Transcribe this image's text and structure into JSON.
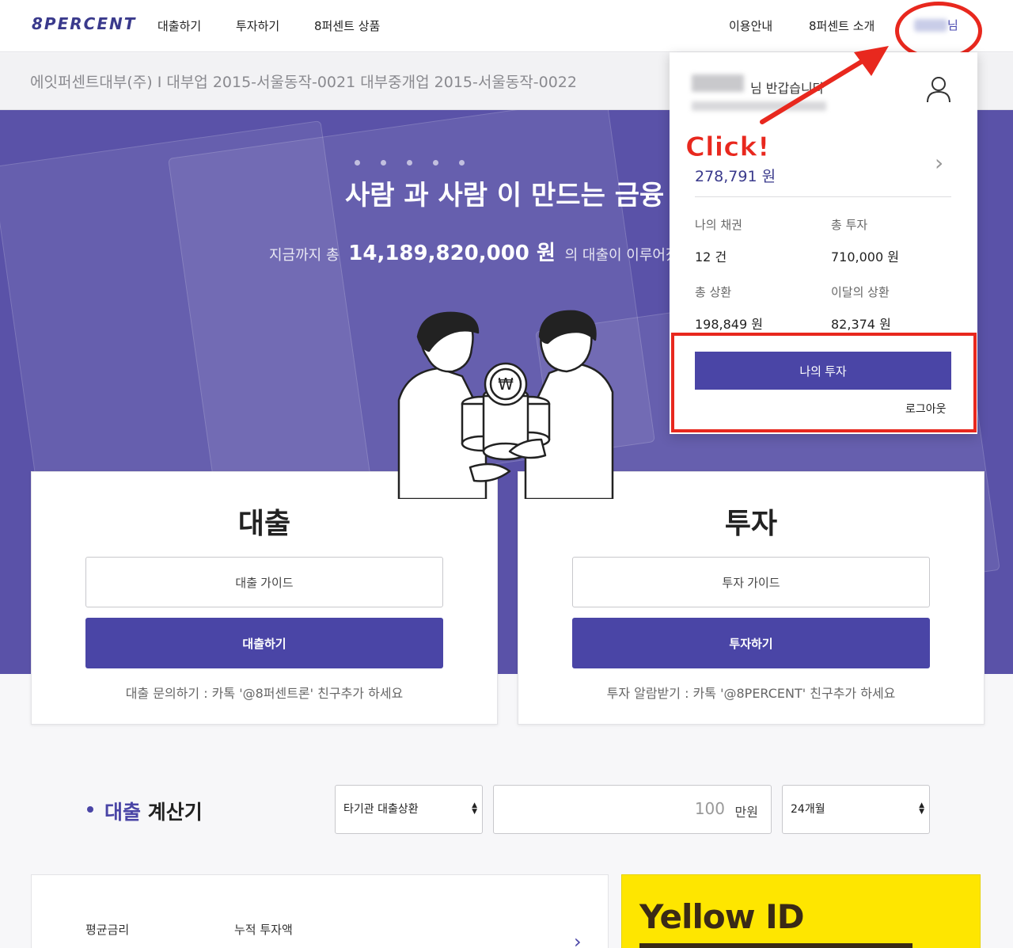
{
  "nav": {
    "logo": "8PERCENT",
    "links": [
      "대출하기",
      "투자하기",
      "8퍼센트 상품"
    ],
    "right_links": [
      "이용안내",
      "8퍼센트 소개"
    ],
    "user_suffix": "님"
  },
  "company": {
    "text": "에잇퍼센트대부(주) I 대부업 2015-서울동작-0021 대부중개업 2015-서울동작-0022"
  },
  "hero": {
    "title": "사람 과 사람 이 만드는 금융",
    "sub_prefix": "지금까지 총",
    "amount": "14,189,820,000 원",
    "sub_suffix": "의 대출이 이루어졌습니다"
  },
  "dropdown": {
    "greeting": "님 반갑습니다",
    "click_annotation": "Click!",
    "balance": "278,791 원",
    "stats": [
      {
        "label": "나의 채권",
        "value": "12 건"
      },
      {
        "label": "총 투자",
        "value": "710,000 원"
      },
      {
        "label": "총 상환",
        "value": "198,849 원"
      },
      {
        "label": "이달의 상환",
        "value": "82,374 원"
      }
    ],
    "my_invest_button": "나의 투자",
    "logout": "로그아웃"
  },
  "cards": {
    "loan": {
      "title": "대출",
      "guide_button": "대출 가이드",
      "action_button": "대출하기",
      "note": "대출 문의하기 : 카톡 '@8퍼센트론' 친구추가 하세요"
    },
    "invest": {
      "title": "투자",
      "guide_button": "투자 가이드",
      "action_button": "투자하기",
      "note": "투자 알람받기 : 카톡 '@8PERCENT' 친구추가 하세요"
    }
  },
  "calculator": {
    "title_accent": "대출",
    "title_rest": " 계산기",
    "type_select": "타기관 대출상환",
    "amount_value": "100",
    "amount_unit": "만원",
    "term_select": "24개월"
  },
  "bottom": {
    "avg_rate_label": "평균금리",
    "cumulative_label": "누적 투자액",
    "yellow_id": "Yellow ID"
  },
  "colors": {
    "brand": "#4a45a6",
    "hero_bg": "#5a52a8",
    "annotation_red": "#e8281e",
    "kakao_yellow": "#fee600"
  }
}
